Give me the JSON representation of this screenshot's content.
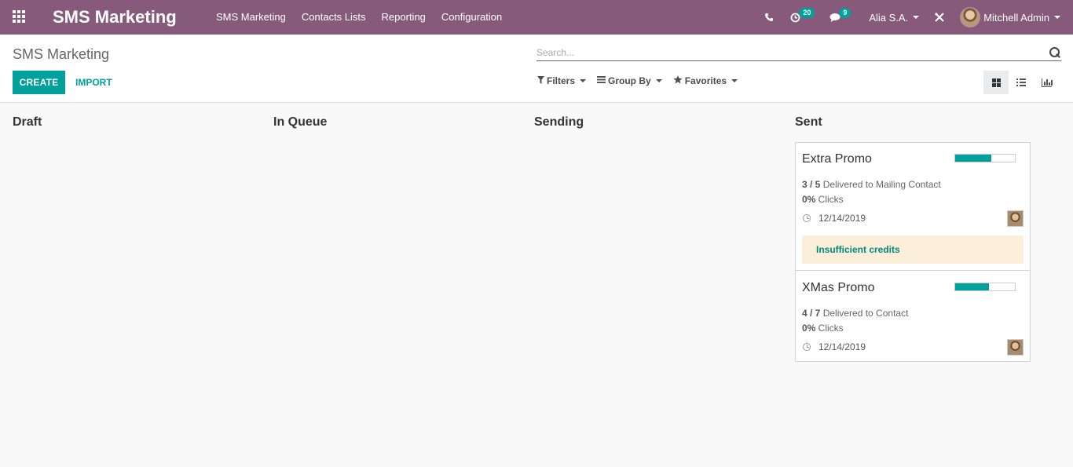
{
  "navbar": {
    "brand": "SMS Marketing",
    "menu": [
      "SMS Marketing",
      "Contacts Lists",
      "Reporting",
      "Configuration"
    ],
    "activity_count": "20",
    "message_count": "9",
    "company": "Alia S.A.",
    "user": "Mitchell Admin",
    "background_color": "#875a7b"
  },
  "control_panel": {
    "breadcrumb": "SMS Marketing",
    "create_label": "CREATE",
    "import_label": "IMPORT",
    "search_placeholder": "Search...",
    "filters_label": "Filters",
    "group_by_label": "Group By",
    "favorites_label": "Favorites",
    "active_view": "kanban"
  },
  "columns": [
    "Draft",
    "In Queue",
    "Sending",
    "Sent"
  ],
  "cards": [
    {
      "title": "Extra Promo",
      "delivered_count": "3 / 5",
      "delivered_text": " Delivered to Mailing Contact",
      "clicks_value": "0%",
      "clicks_text": " Clicks",
      "date": "12/14/2019",
      "progress": 0.6,
      "warning": "Insufficient credits"
    },
    {
      "title": "XMas Promo",
      "delivered_count": "4 / 7",
      "delivered_text": " Delivered to Contact",
      "clicks_value": "0%",
      "clicks_text": " Clicks",
      "date": "12/14/2019",
      "progress": 0.571
    }
  ],
  "colors": {
    "accent": "#00a09d",
    "warning_bg": "#fbefd9"
  }
}
